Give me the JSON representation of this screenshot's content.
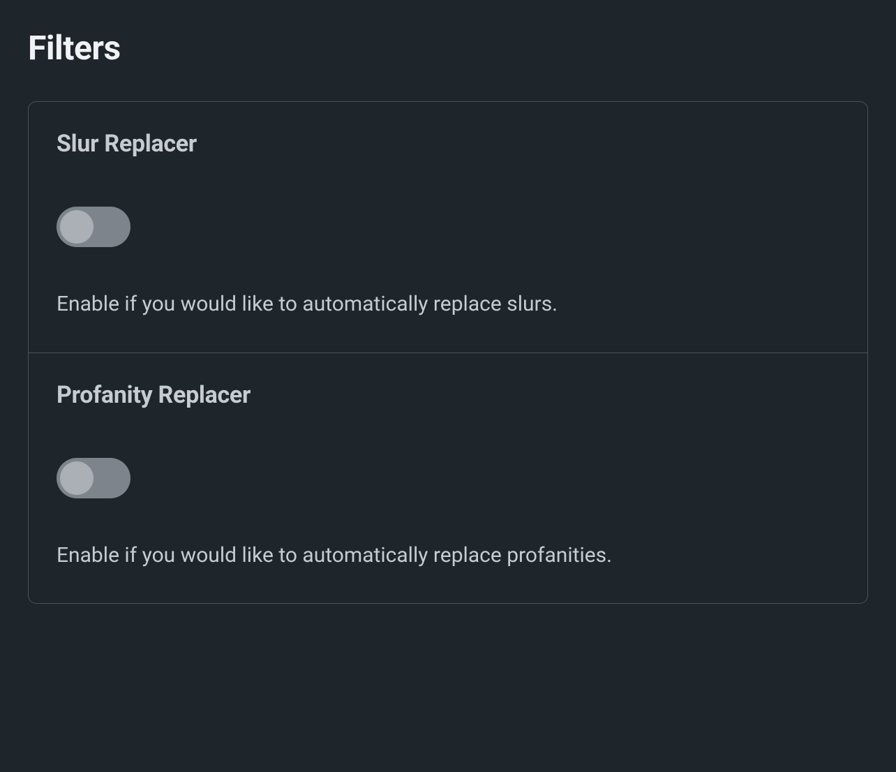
{
  "page": {
    "title": "Filters"
  },
  "filters": [
    {
      "title": "Slur Replacer",
      "description": "Enable if you would like to automatically replace slurs.",
      "enabled": false
    },
    {
      "title": "Profanity Replacer",
      "description": "Enable if you would like to automatically replace profanities.",
      "enabled": false
    }
  ]
}
